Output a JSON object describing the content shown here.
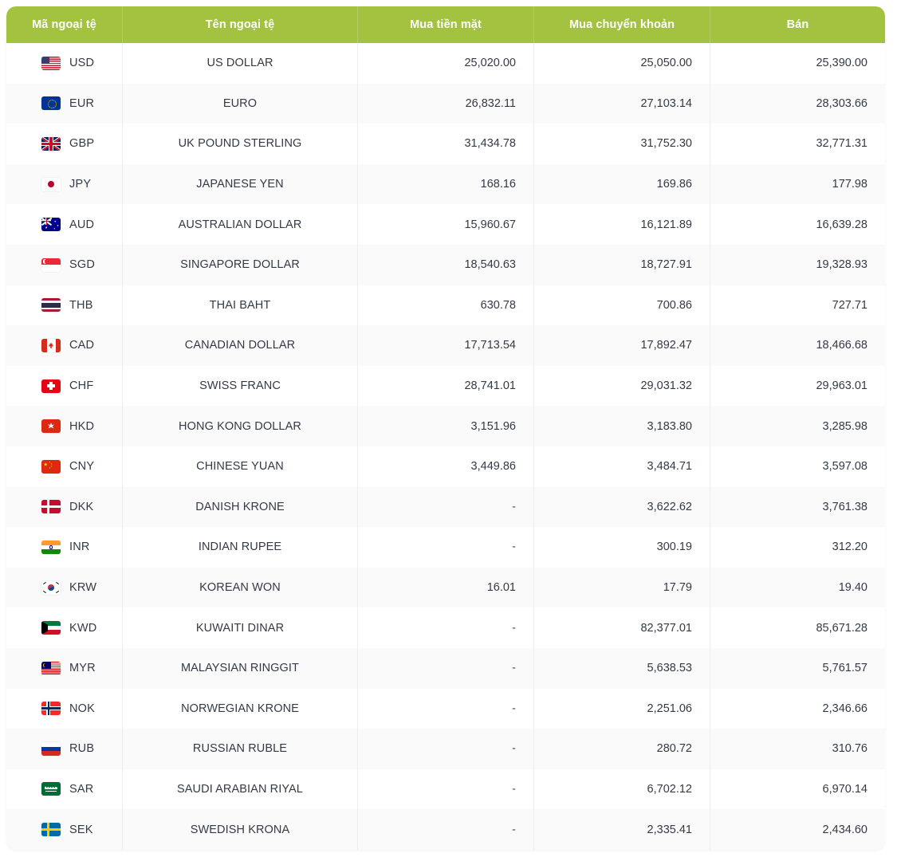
{
  "table": {
    "headers": {
      "code": "Mã ngoại tệ",
      "name": "Tên ngoại tệ",
      "buy_cash": "Mua tiền mặt",
      "buy_transfer": "Mua chuyển khoản",
      "sell": "Bán"
    },
    "accent_color": "#a3c23f",
    "rows": [
      {
        "flag": "us-flag-icon",
        "flag_class": "f-usd",
        "code": "USD",
        "name": "US DOLLAR",
        "buy_cash": "25,020.00",
        "buy_transfer": "25,050.00",
        "sell": "25,390.00"
      },
      {
        "flag": "eu-flag-icon",
        "flag_class": "f-eur",
        "code": "EUR",
        "name": "EURO",
        "buy_cash": "26,832.11",
        "buy_transfer": "27,103.14",
        "sell": "28,303.66"
      },
      {
        "flag": "gb-flag-icon",
        "flag_class": "f-gbp",
        "code": "GBP",
        "name": "UK POUND STERLING",
        "buy_cash": "31,434.78",
        "buy_transfer": "31,752.30",
        "sell": "32,771.31"
      },
      {
        "flag": "jp-flag-icon",
        "flag_class": "f-jpy",
        "code": "JPY",
        "name": "JAPANESE YEN",
        "buy_cash": "168.16",
        "buy_transfer": "169.86",
        "sell": "177.98"
      },
      {
        "flag": "au-flag-icon",
        "flag_class": "f-aud",
        "code": "AUD",
        "name": "AUSTRALIAN DOLLAR",
        "buy_cash": "15,960.67",
        "buy_transfer": "16,121.89",
        "sell": "16,639.28"
      },
      {
        "flag": "sg-flag-icon",
        "flag_class": "f-sgd",
        "code": "SGD",
        "name": "SINGAPORE DOLLAR",
        "buy_cash": "18,540.63",
        "buy_transfer": "18,727.91",
        "sell": "19,328.93"
      },
      {
        "flag": "th-flag-icon",
        "flag_class": "f-thb",
        "code": "THB",
        "name": "THAI BAHT",
        "buy_cash": "630.78",
        "buy_transfer": "700.86",
        "sell": "727.71"
      },
      {
        "flag": "ca-flag-icon",
        "flag_class": "f-cad",
        "code": "CAD",
        "name": "CANADIAN DOLLAR",
        "buy_cash": "17,713.54",
        "buy_transfer": "17,892.47",
        "sell": "18,466.68"
      },
      {
        "flag": "ch-flag-icon",
        "flag_class": "f-chf",
        "code": "CHF",
        "name": "SWISS FRANC",
        "buy_cash": "28,741.01",
        "buy_transfer": "29,031.32",
        "sell": "29,963.01"
      },
      {
        "flag": "hk-flag-icon",
        "flag_class": "f-hkd",
        "code": "HKD",
        "name": "HONG KONG DOLLAR",
        "buy_cash": "3,151.96",
        "buy_transfer": "3,183.80",
        "sell": "3,285.98"
      },
      {
        "flag": "cn-flag-icon",
        "flag_class": "f-cny",
        "code": "CNY",
        "name": "CHINESE YUAN",
        "buy_cash": "3,449.86",
        "buy_transfer": "3,484.71",
        "sell": "3,597.08"
      },
      {
        "flag": "dk-flag-icon",
        "flag_class": "f-dkk",
        "code": "DKK",
        "name": "DANISH KRONE",
        "buy_cash": "-",
        "buy_transfer": "3,622.62",
        "sell": "3,761.38"
      },
      {
        "flag": "in-flag-icon",
        "flag_class": "f-inr",
        "code": "INR",
        "name": "INDIAN RUPEE",
        "buy_cash": "-",
        "buy_transfer": "300.19",
        "sell": "312.20"
      },
      {
        "flag": "kr-flag-icon",
        "flag_class": "f-krw",
        "code": "KRW",
        "name": "KOREAN WON",
        "buy_cash": "16.01",
        "buy_transfer": "17.79",
        "sell": "19.40"
      },
      {
        "flag": "kw-flag-icon",
        "flag_class": "f-kwd",
        "code": "KWD",
        "name": "KUWAITI DINAR",
        "buy_cash": "-",
        "buy_transfer": "82,377.01",
        "sell": "85,671.28"
      },
      {
        "flag": "my-flag-icon",
        "flag_class": "f-myr",
        "code": "MYR",
        "name": "MALAYSIAN RINGGIT",
        "buy_cash": "-",
        "buy_transfer": "5,638.53",
        "sell": "5,761.57"
      },
      {
        "flag": "no-flag-icon",
        "flag_class": "f-nok",
        "code": "NOK",
        "name": "NORWEGIAN KRONE",
        "buy_cash": "-",
        "buy_transfer": "2,251.06",
        "sell": "2,346.66"
      },
      {
        "flag": "ru-flag-icon",
        "flag_class": "f-rub",
        "code": "RUB",
        "name": "RUSSIAN RUBLE",
        "buy_cash": "-",
        "buy_transfer": "280.72",
        "sell": "310.76"
      },
      {
        "flag": "sa-flag-icon",
        "flag_class": "f-sar",
        "code": "SAR",
        "name": "SAUDI ARABIAN RIYAL",
        "buy_cash": "-",
        "buy_transfer": "6,702.12",
        "sell": "6,970.14"
      },
      {
        "flag": "se-flag-icon",
        "flag_class": "f-sek",
        "code": "SEK",
        "name": "SWEDISH KRONA",
        "buy_cash": "-",
        "buy_transfer": "2,335.41",
        "sell": "2,434.60"
      }
    ]
  }
}
